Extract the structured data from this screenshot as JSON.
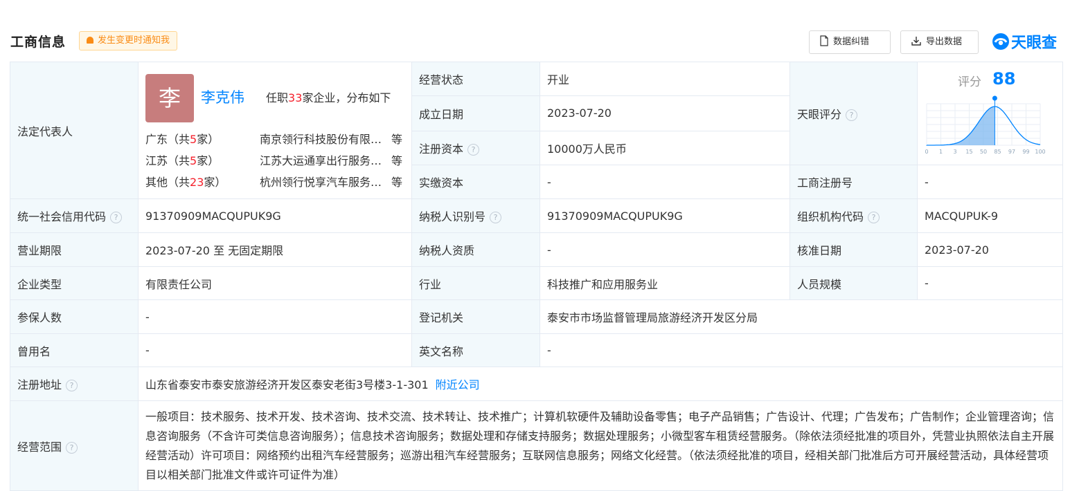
{
  "header": {
    "title": "工商信息",
    "notify_label": "发生变更时通知我",
    "correct_label": "数据纠错",
    "export_label": "导出数据",
    "logo_text": "天眼查"
  },
  "legal_rep": {
    "label": "法定代表人",
    "avatar_char": "李",
    "name": "李克伟",
    "info_prefix": "任职",
    "info_count": "33",
    "info_suffix": "家企业，分布如下",
    "rows": [
      {
        "region": "广东（共",
        "count": "5",
        "unit": "家）",
        "company": "南京领行科技股份有限公司",
        "etc": "等"
      },
      {
        "region": "江苏（共",
        "count": "5",
        "unit": "家）",
        "company": "江苏大运通享出行服务有限公司",
        "etc": "等"
      },
      {
        "region": "其他（共",
        "count": "23",
        "unit": "家）",
        "company": "杭州领行悦享汽车服务有限公司",
        "etc": "等"
      }
    ]
  },
  "fields": {
    "status_label": "经营状态",
    "status_value": "开业",
    "found_label": "成立日期",
    "found_value": "2023-07-20",
    "capital_label": "注册资本",
    "capital_value": "10000万人民币",
    "paid_label": "实缴资本",
    "paid_value": "-",
    "score_label": "天眼评分",
    "regno_label": "工商注册号",
    "regno_value": "-",
    "credit_label": "统一社会信用代码",
    "credit_value": "91370909MACQUPUK9G",
    "taxid_label": "纳税人识别号",
    "taxid_value": "91370909MACQUPUK9G",
    "org_label": "组织机构代码",
    "org_value": "MACQUPUK-9",
    "term_label": "营业期限",
    "term_value": "2023-07-20 至 无固定期限",
    "taxq_label": "纳税人资质",
    "taxq_value": "-",
    "approve_label": "核准日期",
    "approve_value": "2023-07-20",
    "type_label": "企业类型",
    "type_value": "有限责任公司",
    "industry_label": "行业",
    "industry_value": "科技推广和应用服务业",
    "staff_label": "人员规模",
    "staff_value": "-",
    "insured_label": "参保人数",
    "insured_value": "-",
    "authority_label": "登记机关",
    "authority_value": "泰安市市场监督管理局旅游经济开发区分局",
    "former_label": "曾用名",
    "former_value": "-",
    "english_label": "英文名称",
    "english_value": "-",
    "address_label": "注册地址",
    "address_value": "山东省泰安市泰安旅游经济开发区泰安老街3号楼3-1-301",
    "nearby_label": "附近公司",
    "scope_label": "经营范围",
    "scope_value": "一般项目：技术服务、技术开发、技术咨询、技术交流、技术转让、技术推广；计算机软硬件及辅助设备零售；电子产品销售；广告设计、代理；广告发布；广告制作；企业管理咨询；信息咨询服务（不含许可类信息咨询服务）；信息技术咨询服务；数据处理和存储支持服务；数据处理服务；小微型客车租赁经营服务。（除依法须经批准的项目外，凭营业执照依法自主开展经营活动）许可项目：网络预约出租汽车经营服务；巡游出租汽车经营服务；互联网信息服务；网络文化经营。（依法须经批准的项目，经相关部门批准后方可开展经营活动，具体经营项目以相关部门批准文件或许可证件为准）"
  },
  "score": {
    "label": "评分",
    "value": "88",
    "ticks": [
      "0",
      "1",
      "3",
      "15",
      "50",
      "85",
      "97",
      "99",
      "100"
    ],
    "marker_fraction": 0.6,
    "colors": {
      "accent": "#0084ff",
      "curve_fill": "#7fb8f0"
    }
  },
  "help_icon": "?"
}
